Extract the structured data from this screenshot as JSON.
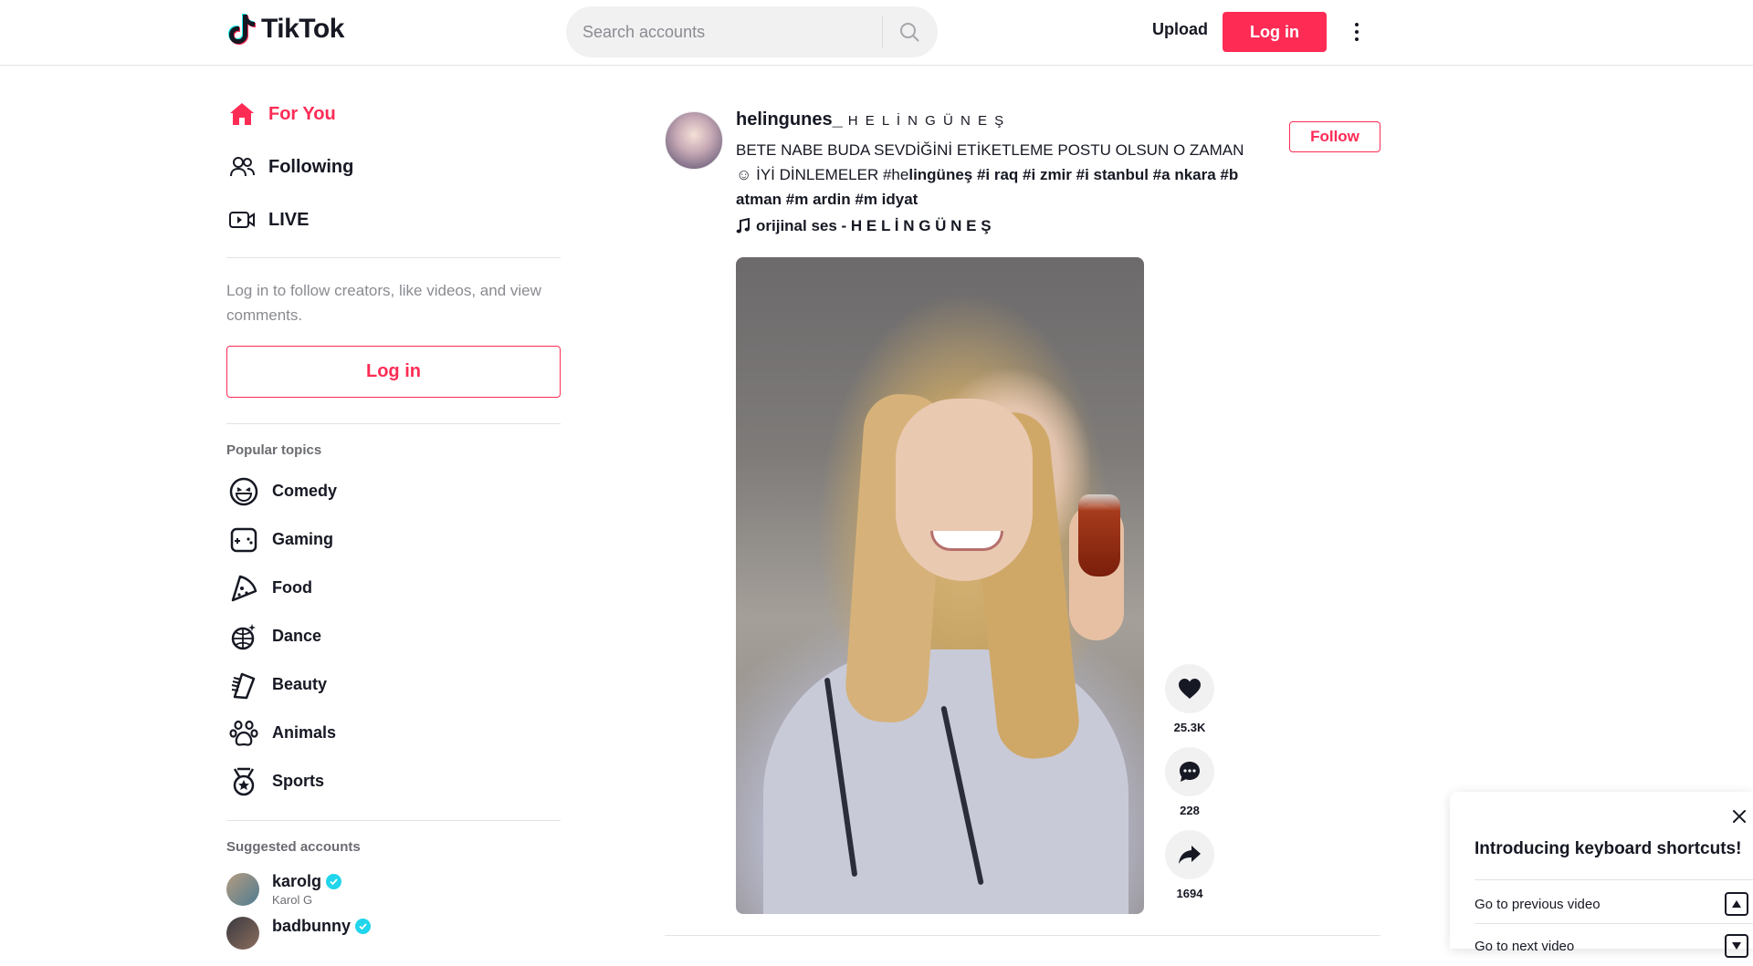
{
  "header": {
    "brand": "TikTok",
    "search_placeholder": "Search accounts",
    "upload_label": "Upload",
    "login_label": "Log in"
  },
  "sidebar": {
    "nav": [
      {
        "label": "For You",
        "icon": "home-icon",
        "active": true
      },
      {
        "label": "Following",
        "icon": "users-icon",
        "active": false
      },
      {
        "label": "LIVE",
        "icon": "live-icon",
        "active": false
      }
    ],
    "login_prompt": "Log in to follow creators, like videos, and view comments.",
    "login_button": "Log in",
    "popular_topics_title": "Popular topics",
    "topics": [
      {
        "label": "Comedy",
        "icon": "comedy-icon"
      },
      {
        "label": "Gaming",
        "icon": "gaming-icon"
      },
      {
        "label": "Food",
        "icon": "food-icon"
      },
      {
        "label": "Dance",
        "icon": "dance-icon"
      },
      {
        "label": "Beauty",
        "icon": "beauty-icon"
      },
      {
        "label": "Animals",
        "icon": "animals-icon"
      },
      {
        "label": "Sports",
        "icon": "sports-icon"
      }
    ],
    "suggested_title": "Suggested accounts",
    "accounts": [
      {
        "username": "karolg",
        "nickname": "Karol G",
        "verified": true
      },
      {
        "username": "badbunny",
        "nickname": "",
        "verified": true
      }
    ]
  },
  "post": {
    "author": "helingunes_",
    "author_nick": "H E L İ N G Ü N E Ş",
    "caption_line1": "BETE NABE BUDA SEVDİĞİNİ ETİKETLEME POSTU OLSUN O ZAMAN",
    "caption_line2_plain": "İYİ DİNLEMELER #he",
    "caption_line2_bold": "lingüneş #i raq #i zmir #i stanbul #a nkara #b",
    "caption_line3": "atman #m ardin #m idyat",
    "music": "orijinal ses -  H E L İ N G Ü N E Ş",
    "follow_label": "Follow",
    "likes": "25.3K",
    "comments": "228",
    "shares": "1694"
  },
  "shortcuts": {
    "title": "Introducing keyboard shortcuts!",
    "items": [
      {
        "label": "Go to previous video"
      },
      {
        "label": "Go to next video"
      }
    ]
  },
  "colors": {
    "accent": "#fe2c55",
    "text": "#161823",
    "muted": "#8a8b91",
    "verified": "#20d5ec"
  }
}
